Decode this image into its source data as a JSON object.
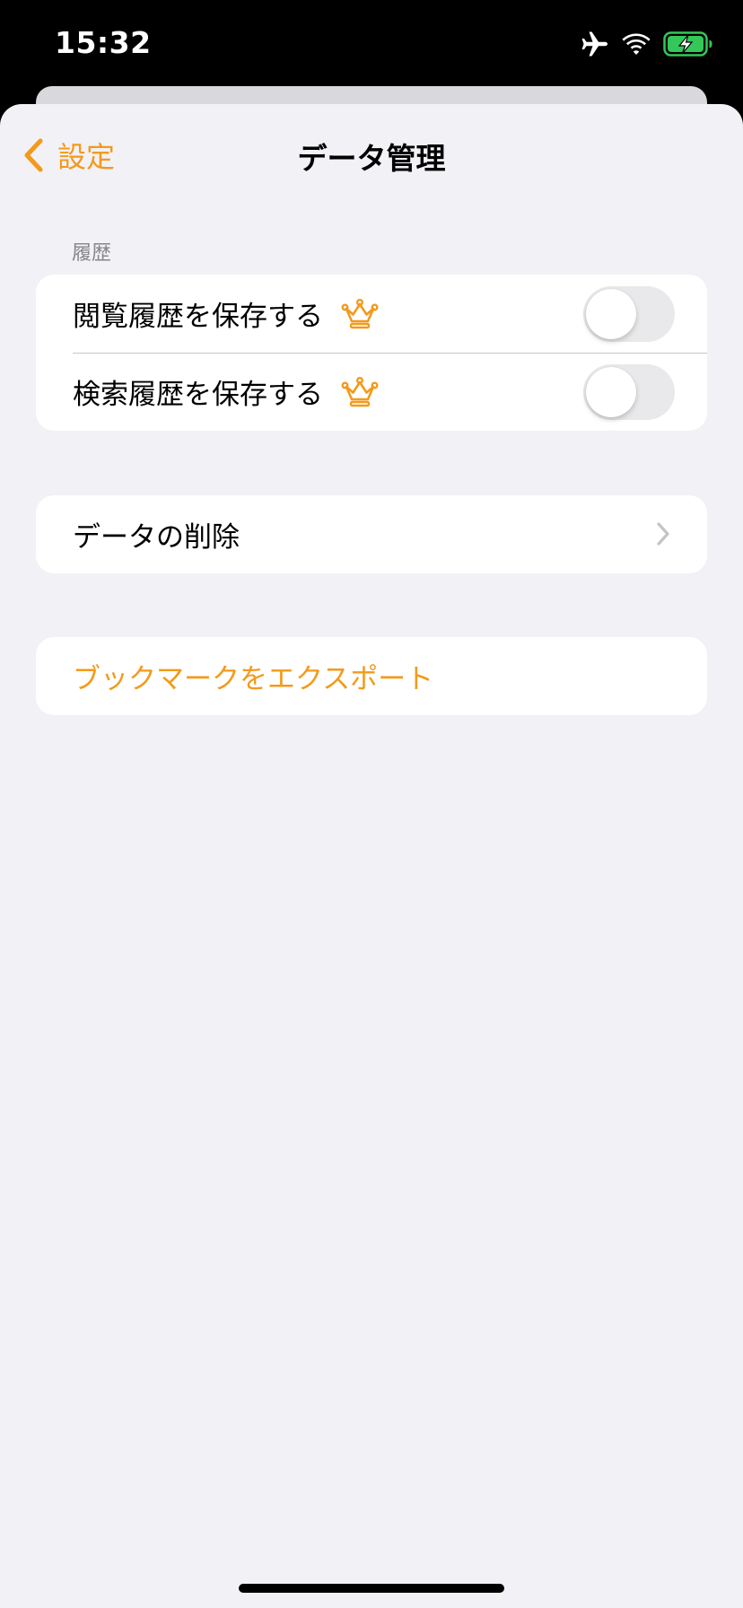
{
  "status_bar": {
    "time": "15:32",
    "icons": [
      "airplane-icon",
      "wifi-icon",
      "battery-charging-icon"
    ]
  },
  "nav": {
    "back_label": "設定",
    "title": "データ管理"
  },
  "history_section": {
    "header": "履歴",
    "items": [
      {
        "label": "閲覧履歴を保存する",
        "premium_icon": "crown-icon",
        "toggle_on": false
      },
      {
        "label": "検索履歴を保存する",
        "premium_icon": "crown-icon",
        "toggle_on": false
      }
    ]
  },
  "data_section": {
    "delete_label": "データの削除"
  },
  "export_section": {
    "export_label": "ブックマークをエクスポート"
  },
  "colors": {
    "accent": "#f39a1b",
    "background": "#f1f1f6",
    "card": "#ffffff",
    "toggle_off": "#e9e9eb",
    "battery": "#34c759"
  }
}
